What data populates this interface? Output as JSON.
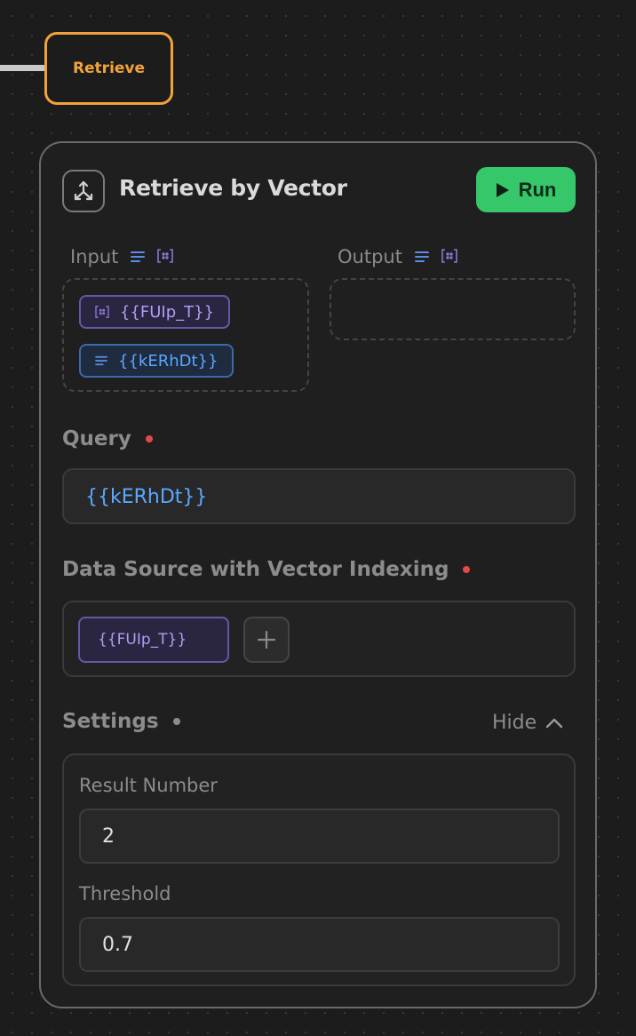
{
  "canvas": {
    "retrieve_tag": "Retrieve"
  },
  "node": {
    "title": "Retrieve by Vector",
    "run_label": "Run",
    "input_label": "Input",
    "output_label": "Output",
    "input_chips": [
      {
        "label": "{{FUIp_T}}",
        "kind": "list"
      },
      {
        "label": "{{kERhDt}}",
        "kind": "text"
      }
    ],
    "query": {
      "label": "Query",
      "value": "{{kERhDt}}"
    },
    "data_source": {
      "label": "Data Source with Vector Indexing",
      "chip": "{{FUIp_T}}"
    },
    "settings": {
      "label": "Settings",
      "toggle_label": "Hide",
      "result_number_label": "Result Number",
      "result_number_value": "2",
      "threshold_label": "Threshold",
      "threshold_value": "0.7"
    }
  },
  "colors": {
    "accent_orange": "#f2a23c",
    "run_green": "#36c76a",
    "variable_purple": "#b39cf2",
    "variable_blue": "#5aa8ff",
    "required_red": "#e54848"
  }
}
